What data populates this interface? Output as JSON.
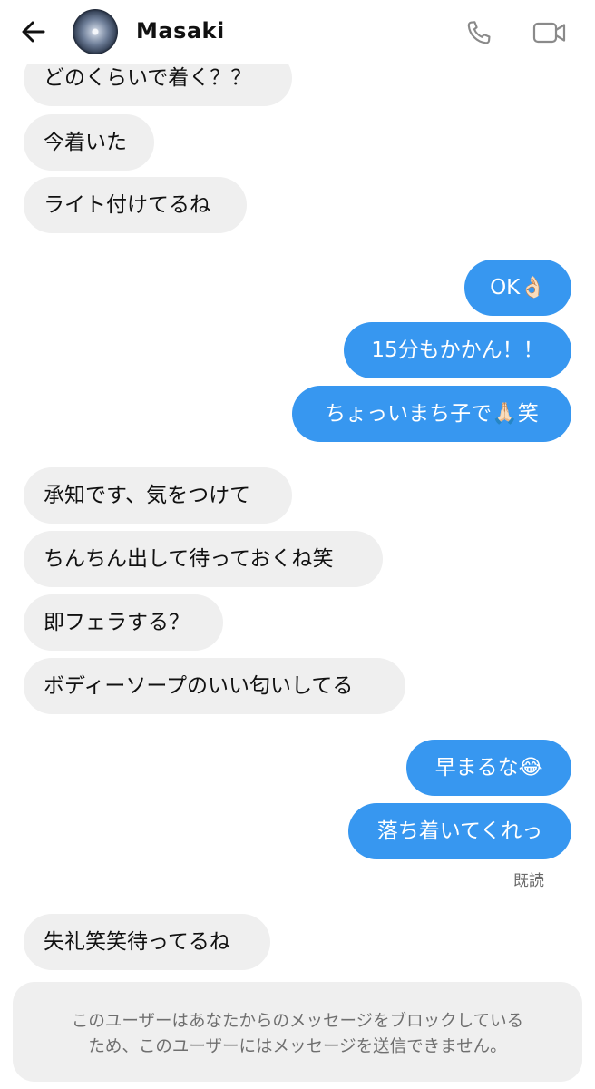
{
  "header": {
    "contact_name": "Masaki"
  },
  "messages": [
    {
      "side": "in",
      "text": "どのくらいで着く？？"
    },
    {
      "side": "in",
      "text": "今着いた"
    },
    {
      "side": "in",
      "text": "ライト付けてるね"
    },
    {
      "side": "out",
      "text": "OK👌🏻"
    },
    {
      "side": "out",
      "text": "15分もかかん！！"
    },
    {
      "side": "out",
      "text": "ちょっいまち子で🙏🏻笑"
    },
    {
      "side": "in",
      "text": "承知です、気をつけて"
    },
    {
      "side": "in",
      "text": "ちんちん出して待っておくね笑"
    },
    {
      "side": "in",
      "text": "即フェラする？"
    },
    {
      "side": "in",
      "text": "ボディーソープのいい匂いしてる"
    },
    {
      "side": "out",
      "text": "早まるな😂"
    },
    {
      "side": "out",
      "text": "落ち着いてくれっ"
    },
    {
      "side": "in",
      "text": "失礼笑笑待ってるね"
    }
  ],
  "read_receipt": "既読",
  "block_notice": {
    "line1": "このユーザーはあなたからのメッセージをブロックしている",
    "line2": "ため、このユーザーにはメッセージを送信できません。"
  },
  "colors": {
    "outgoing_bubble": "#3797f0",
    "incoming_bubble": "#efefef",
    "notice_background": "#efefef"
  },
  "icons": {
    "back": "arrow-left-icon",
    "call": "phone-icon",
    "video": "video-camera-icon"
  }
}
